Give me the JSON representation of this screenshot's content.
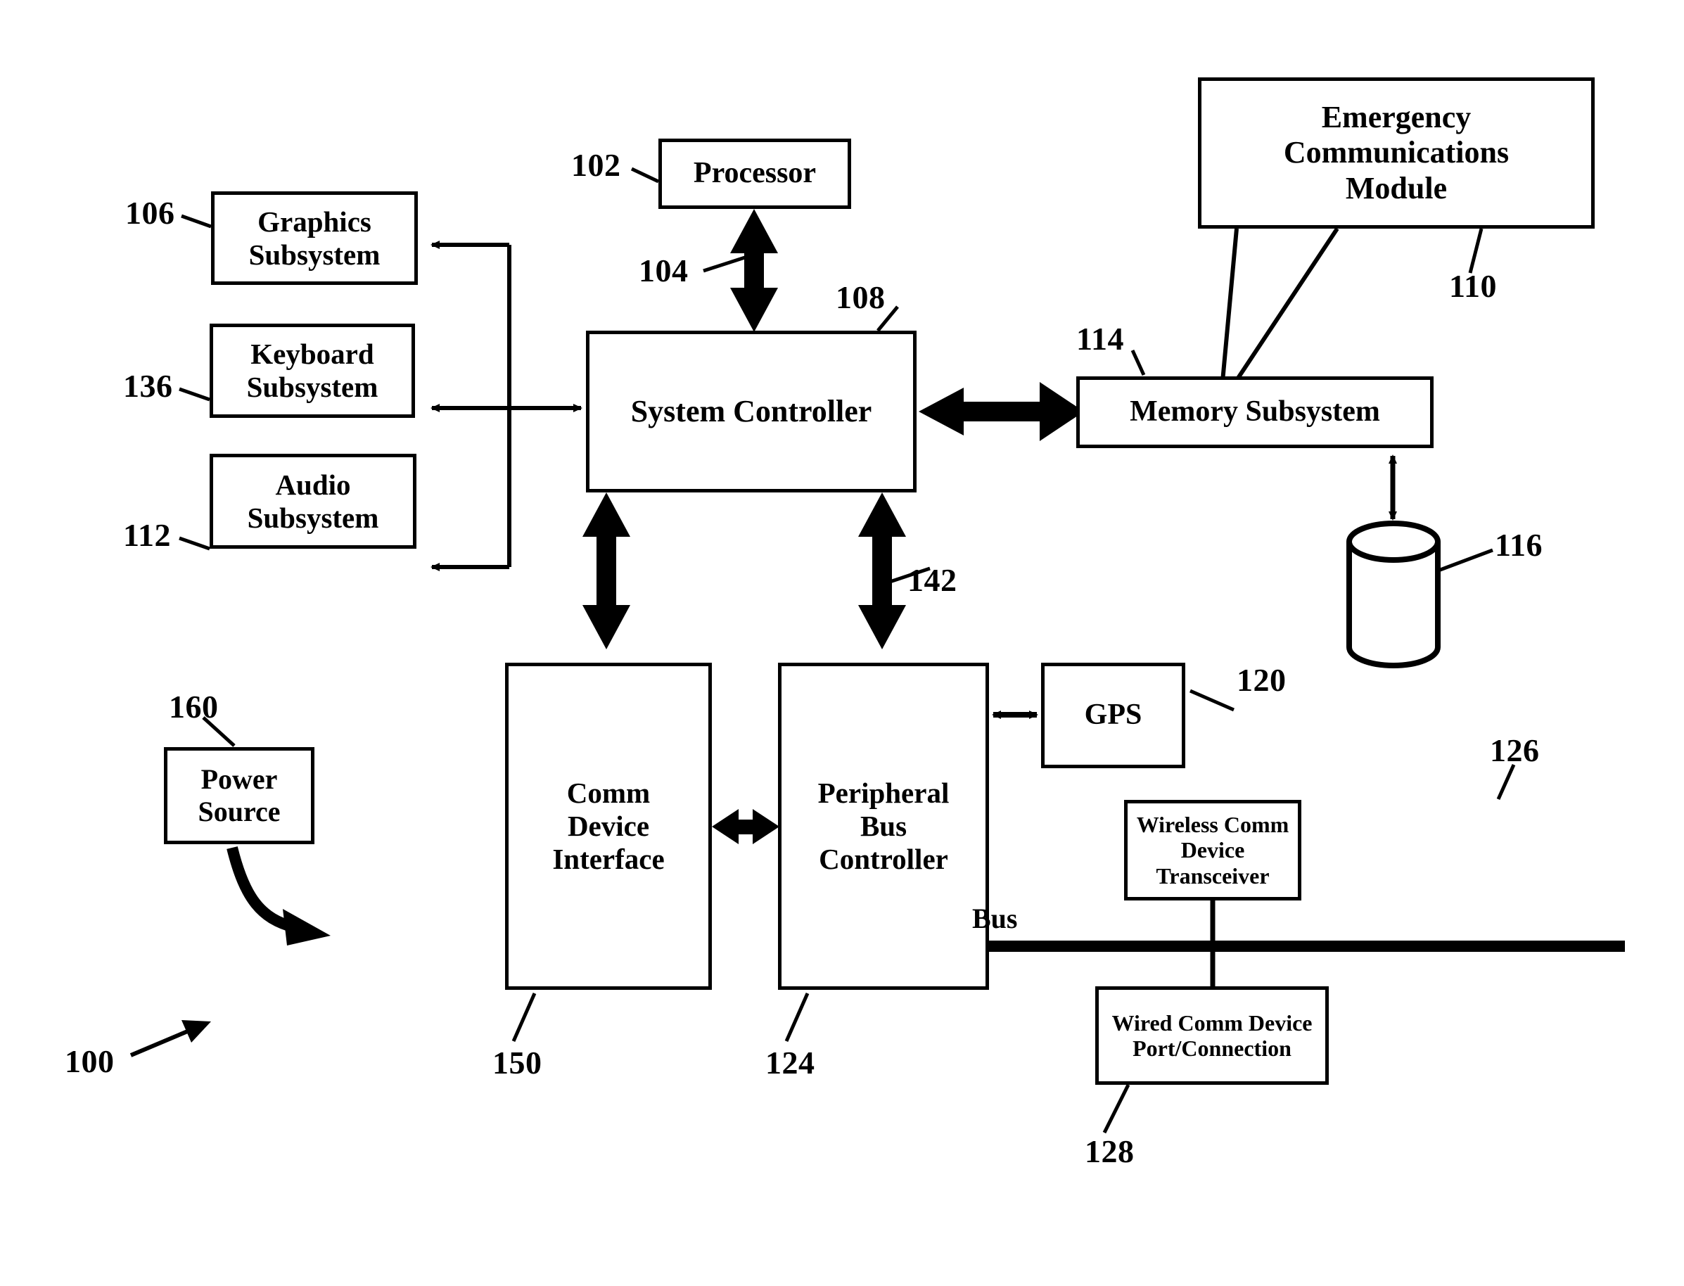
{
  "figure": {
    "type": "patent-block-diagram",
    "figure_ref": "100",
    "bus_label": "Bus"
  },
  "blocks": [
    {
      "id": "graphics",
      "label": "Graphics\nSubsystem",
      "ref": "106"
    },
    {
      "id": "keyboard",
      "label": "Keyboard\nSubsystem",
      "ref": "136"
    },
    {
      "id": "audio",
      "label": "Audio\nSubsystem",
      "ref": "112"
    },
    {
      "id": "processor",
      "label": "Processor",
      "ref": "102"
    },
    {
      "id": "syscon",
      "label": "System Controller",
      "ref": "108"
    },
    {
      "id": "ecm",
      "label": "Emergency\nCommunications\nModule",
      "ref": "110"
    },
    {
      "id": "memory",
      "label": "Memory Subsystem",
      "ref": "114"
    },
    {
      "id": "storage",
      "label": "",
      "ref": "116"
    },
    {
      "id": "gps",
      "label": "GPS",
      "ref": "120"
    },
    {
      "id": "commif",
      "label": "Comm\nDevice\nInterface",
      "ref": "150"
    },
    {
      "id": "pbc",
      "label": "Peripheral\nBus\nController",
      "ref": "124"
    },
    {
      "id": "wireless",
      "label": "Wireless Comm Device\nTransceiver",
      "ref": "126"
    },
    {
      "id": "wired",
      "label": "Wired Comm Device\nPort/Connection",
      "ref": "128"
    },
    {
      "id": "power",
      "label": "Power\nSource",
      "ref": "160"
    }
  ],
  "labels": {
    "graphics_line1": "Graphics",
    "graphics_line2": "Subsystem",
    "keyboard_line1": "Keyboard",
    "keyboard_line2": "Subsystem",
    "audio_line1": "Audio",
    "audio_line2": "Subsystem",
    "processor": "Processor",
    "system_controller": "System Controller",
    "ecm_line1": "Emergency",
    "ecm_line2": "Communications",
    "ecm_line3": "Module",
    "memory_subsystem": "Memory Subsystem",
    "gps": "GPS",
    "commif_line1": "Comm",
    "commif_line2": "Device",
    "commif_line3": "Interface",
    "pbc_line1": "Peripheral",
    "pbc_line2": "Bus",
    "pbc_line3": "Controller",
    "wireless_line1": "Wireless Comm Device",
    "wireless_line2": "Transceiver",
    "wired_line1": "Wired Comm Device",
    "wired_line2": "Port/Connection",
    "power_line1": "Power",
    "power_line2": "Source",
    "bus": "Bus"
  },
  "refs": {
    "graphics": "106",
    "keyboard": "136",
    "audio": "112",
    "processor": "102",
    "proc_link": "104",
    "system_controller": "108",
    "ecm": "110",
    "memory": "114",
    "storage": "116",
    "gps": "120",
    "commif": "150",
    "pbc": "124",
    "pbc_link": "142",
    "wireless": "126",
    "wired": "128",
    "power": "160",
    "figure": "100"
  },
  "colors": {
    "stroke": "#000000",
    "background": "#ffffff"
  }
}
